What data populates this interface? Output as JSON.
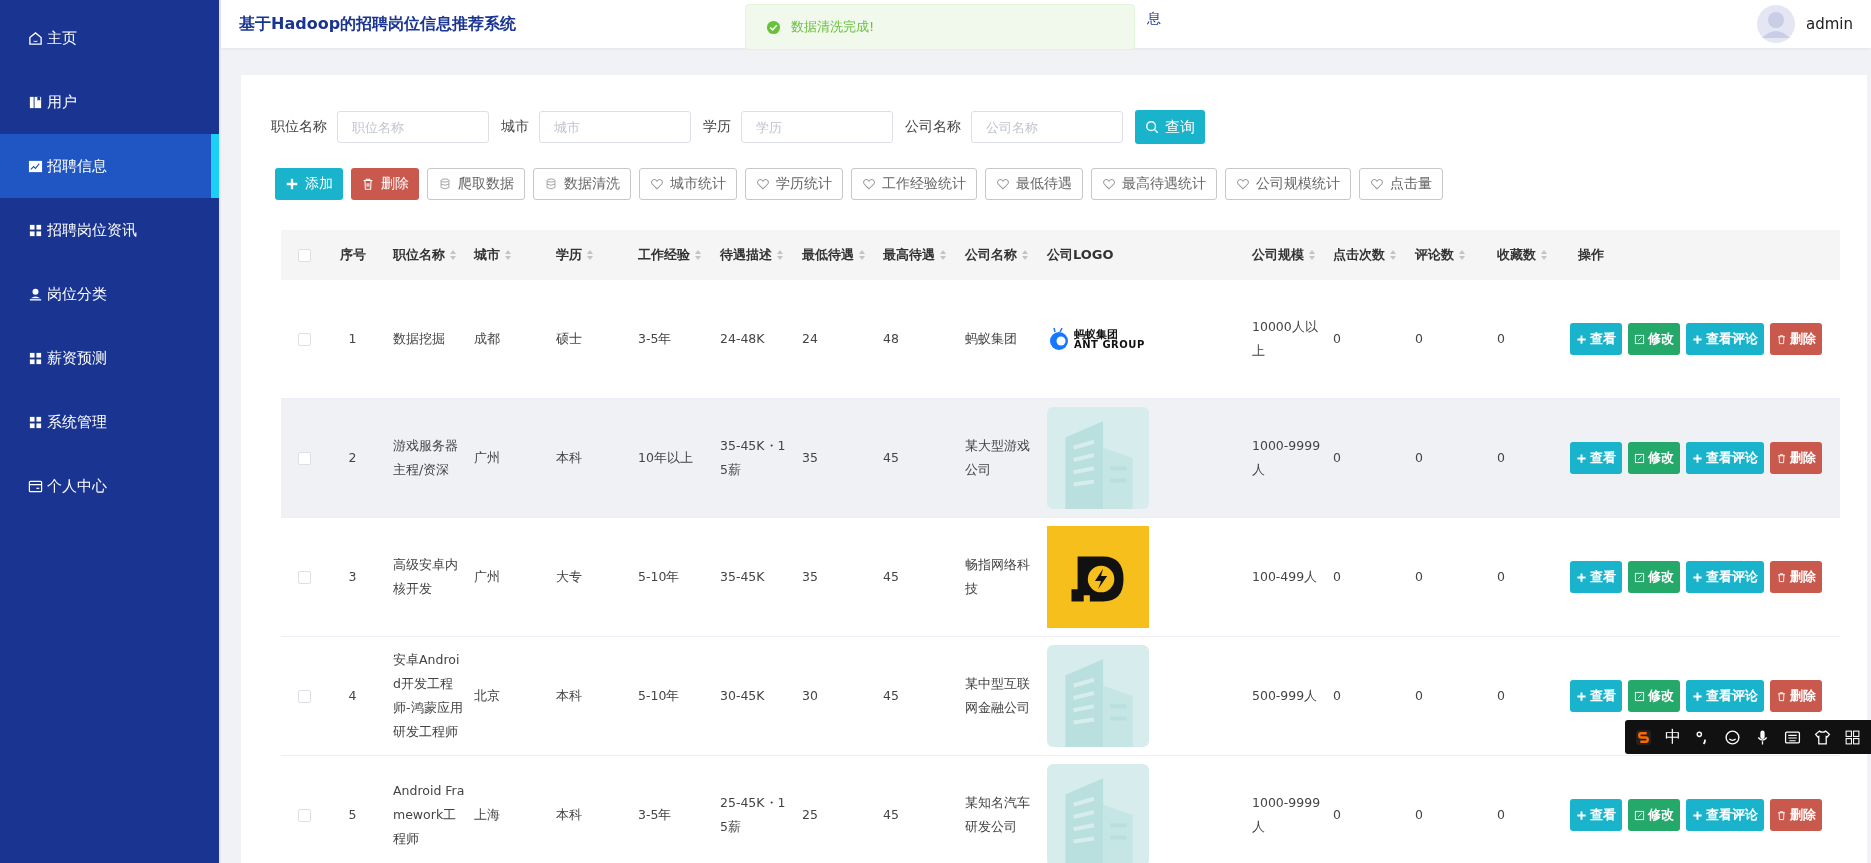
{
  "sidebar": {
    "items": [
      {
        "label": "主页",
        "kind": "home",
        "selected": false
      },
      {
        "label": "用户",
        "kind": "book",
        "selected": false
      },
      {
        "label": "招聘信息",
        "kind": "chart",
        "selected": true
      },
      {
        "label": "招聘岗位资讯",
        "kind": "grid",
        "selected": false
      },
      {
        "label": "岗位分类",
        "kind": "person",
        "selected": false
      },
      {
        "label": "薪资预测",
        "kind": "grid",
        "selected": false
      },
      {
        "label": "系统管理",
        "kind": "grid",
        "selected": false
      },
      {
        "label": "个人中心",
        "kind": "card",
        "selected": false
      }
    ]
  },
  "header": {
    "title": "基于Hadoop的招聘岗位信息推荐系统",
    "nav_fragment": "息",
    "user": "admin"
  },
  "toast": {
    "kind": "success",
    "message": "数据清洗完成!"
  },
  "filters": [
    {
      "label": "职位名称",
      "placeholder": "职位名称"
    },
    {
      "label": "城市",
      "placeholder": "城市"
    },
    {
      "label": "学历",
      "placeholder": "学历"
    },
    {
      "label": "公司名称",
      "placeholder": "公司名称"
    }
  ],
  "search_button": "查询",
  "toolbar": [
    {
      "label": "添加",
      "kind": "add"
    },
    {
      "label": "删除",
      "kind": "delete"
    },
    {
      "label": "爬取数据",
      "kind": "data"
    },
    {
      "label": "数据清洗",
      "kind": "data"
    },
    {
      "label": "城市统计",
      "kind": "stat"
    },
    {
      "label": "学历统计",
      "kind": "stat"
    },
    {
      "label": "工作经验统计",
      "kind": "stat"
    },
    {
      "label": "最低待遇",
      "kind": "stat"
    },
    {
      "label": "最高待遇统计",
      "kind": "stat"
    },
    {
      "label": "公司规模统计",
      "kind": "stat"
    },
    {
      "label": "点击量",
      "kind": "stat"
    }
  ],
  "table": {
    "select_all": false,
    "columns": [
      {
        "label": "序号",
        "sortable": false
      },
      {
        "label": "职位名称",
        "sortable": true
      },
      {
        "label": "城市",
        "sortable": true
      },
      {
        "label": "学历",
        "sortable": true
      },
      {
        "label": "工作经验",
        "sortable": true
      },
      {
        "label": "待遇描述",
        "sortable": true
      },
      {
        "label": "最低待遇",
        "sortable": true
      },
      {
        "label": "最高待遇",
        "sortable": true
      },
      {
        "label": "公司名称",
        "sortable": true
      },
      {
        "label": "公司LOGO",
        "sortable": false
      },
      {
        "label": "公司规模",
        "sortable": true
      },
      {
        "label": "点击次数",
        "sortable": true
      },
      {
        "label": "评论数",
        "sortable": true
      },
      {
        "label": "收藏数",
        "sortable": true
      },
      {
        "label": "操作",
        "sortable": false
      }
    ],
    "rows": [
      {
        "checked": false,
        "highlighted": false,
        "cells": [
          "1",
          "数据挖掘",
          "成都",
          "硕士",
          "3-5年",
          "24-48K",
          "24",
          "48",
          "蚂蚁集团"
        ],
        "logo": {
          "kind": "brand",
          "name": "蚂蚁集团",
          "sub": "ANT GROUP"
        },
        "tail": [
          "10000人以上",
          "0",
          "0",
          "0"
        ],
        "actions": [
          {
            "label": "查看",
            "kind": "view"
          },
          {
            "label": "修改",
            "kind": "edit"
          },
          {
            "label": "查看评论",
            "kind": "view"
          },
          {
            "label": "删除",
            "kind": "delete"
          }
        ]
      },
      {
        "checked": false,
        "highlighted": true,
        "cells": [
          "2",
          "游戏服务器主程/资深",
          "广州",
          "本科",
          "10年以上",
          "35-45K・15薪",
          "35",
          "45",
          "某大型游戏公司"
        ],
        "logo": {
          "kind": "picture"
        },
        "tail": [
          "1000-9999人",
          "0",
          "0",
          "0"
        ],
        "actions": [
          {
            "label": "查看",
            "kind": "view"
          },
          {
            "label": "修改",
            "kind": "edit"
          },
          {
            "label": "查看评论",
            "kind": "view"
          },
          {
            "label": "删除",
            "kind": "delete"
          }
        ]
      },
      {
        "checked": false,
        "highlighted": false,
        "cells": [
          "3",
          "高级安卓内核开发",
          "广州",
          "大专",
          "5-10年",
          "35-45K",
          "35",
          "45",
          "畅指网络科技"
        ],
        "logo": {
          "kind": "bolt"
        },
        "tail": [
          "100-499人",
          "0",
          "0",
          "0"
        ],
        "actions": [
          {
            "label": "查看",
            "kind": "view"
          },
          {
            "label": "修改",
            "kind": "edit"
          },
          {
            "label": "查看评论",
            "kind": "view"
          },
          {
            "label": "删除",
            "kind": "delete"
          }
        ]
      },
      {
        "checked": false,
        "highlighted": false,
        "cells": [
          "4",
          "安卓Android开发工程师-鸿蒙应用研发工程师",
          "北京",
          "本科",
          "5-10年",
          "30-45K",
          "30",
          "45",
          "某中型互联网金融公司"
        ],
        "logo": {
          "kind": "picture"
        },
        "tail": [
          "500-999人",
          "0",
          "0",
          "0"
        ],
        "actions": [
          {
            "label": "查看",
            "kind": "view"
          },
          {
            "label": "修改",
            "kind": "edit"
          },
          {
            "label": "查看评论",
            "kind": "view"
          },
          {
            "label": "删除",
            "kind": "delete"
          }
        ]
      },
      {
        "checked": false,
        "highlighted": false,
        "cells": [
          "5",
          "Android Framework工程师",
          "上海",
          "本科",
          "3-5年",
          "25-45K・15薪",
          "25",
          "45",
          "某知名汽车研发公司"
        ],
        "logo": {
          "kind": "picture"
        },
        "tail": [
          "1000-9999人",
          "0",
          "0",
          "0"
        ],
        "actions": [
          {
            "label": "查看",
            "kind": "view"
          },
          {
            "label": "修改",
            "kind": "edit"
          },
          {
            "label": "查看评论",
            "kind": "view"
          },
          {
            "label": "删除",
            "kind": "delete"
          }
        ]
      }
    ]
  },
  "ime_toolbar": {
    "mode": "中"
  }
}
